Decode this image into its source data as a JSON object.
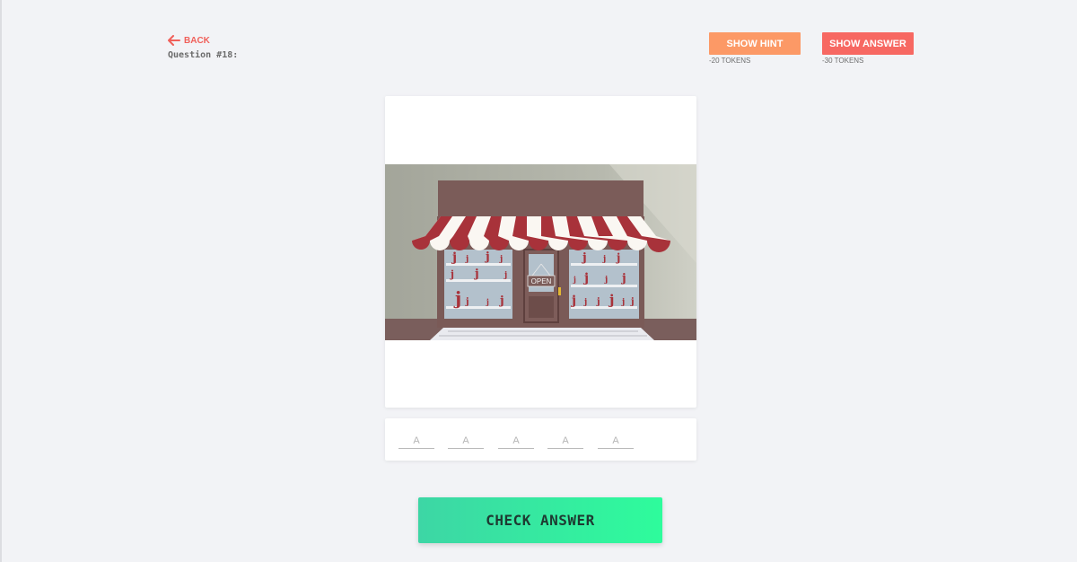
{
  "nav": {
    "back_label": "BACK",
    "question_label": "Question #18:"
  },
  "hint": {
    "button_label": "SHOW HINT",
    "cost": "-20 TOKENS"
  },
  "answer": {
    "button_label": "SHOW ANSWER",
    "cost": "-30 TOKENS"
  },
  "puzzle": {
    "image_icon": "storefront-with-awning",
    "sign_text": "OPEN",
    "window_glyph": "j",
    "letter_placeholders": [
      "A",
      "A",
      "A",
      "A",
      "A"
    ]
  },
  "check": {
    "button_label": "CHECK ANSWER"
  },
  "colors": {
    "back": "#f0605a",
    "hint": "#fc9966",
    "show_answer": "#f76862",
    "check_start": "#3dd6a5",
    "check_end": "#2efc9c",
    "awning_red": "#a8323a",
    "awning_white": "#faf7f2"
  }
}
